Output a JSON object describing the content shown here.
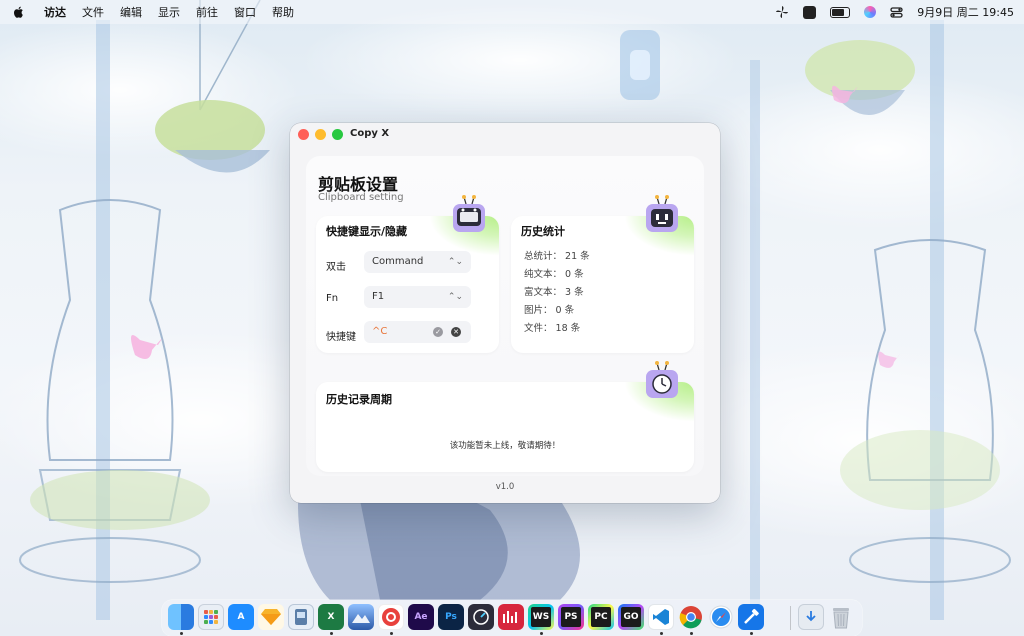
{
  "menubar": {
    "items": [
      "访达",
      "文件",
      "编辑",
      "显示",
      "前往",
      "窗口",
      "帮助"
    ],
    "clock": "9月9日 周二 19:45"
  },
  "window": {
    "title": "Copy X",
    "heading": "剪贴板设置",
    "subheading": "Clipboard setting",
    "shortcut_card": {
      "title": "快捷键显示/隐藏",
      "rows": [
        {
          "label": "双击",
          "value": "Command"
        },
        {
          "label": "Fn",
          "value": "F1"
        },
        {
          "label": "快捷键",
          "value": "^C"
        }
      ]
    },
    "stats_card": {
      "title": "历史统计",
      "lines": [
        "总统计： 21 条",
        "纯文本： 0 条",
        "富文本： 3 条",
        "图片： 0 条",
        "文件： 18 条"
      ]
    },
    "history_card": {
      "title": "历史记录周期",
      "notice": "该功能暂未上线，敬请期待！"
    },
    "version": "v1.0"
  },
  "dock": {
    "apps": [
      {
        "name": "finder",
        "label": "",
        "color": "#2f8bff"
      },
      {
        "name": "launchpad",
        "label": "",
        "color": "#e9eef5"
      },
      {
        "name": "app-store",
        "label": "A",
        "color": "#1e8cff"
      },
      {
        "name": "sketch",
        "label": "",
        "color": "#f7b32b"
      },
      {
        "name": "preview",
        "label": "",
        "color": "#5a7ea8"
      },
      {
        "name": "excel",
        "label": "X",
        "color": "#1d7a43"
      },
      {
        "name": "monterey",
        "label": "",
        "color": "#3b6fb6"
      },
      {
        "name": "netease-music",
        "label": "",
        "color": "#e8413c"
      },
      {
        "name": "after-effects",
        "label": "Ae",
        "color": "#1f0a4a"
      },
      {
        "name": "photoshop",
        "label": "Ps",
        "color": "#0b2445"
      },
      {
        "name": "instruments",
        "label": "",
        "color": "#2c2c3a"
      },
      {
        "name": "mweb",
        "label": "",
        "color": "#d7263d"
      },
      {
        "name": "webstorm",
        "label": "WS",
        "color": "#1b1b1b"
      },
      {
        "name": "phpstorm",
        "label": "PS",
        "color": "#1b1b1b"
      },
      {
        "name": "pycharm",
        "label": "PC",
        "color": "#1b1b1b"
      },
      {
        "name": "goland",
        "label": "GO",
        "color": "#1b1b1b"
      },
      {
        "name": "vscode",
        "label": "",
        "color": "#1a84d6"
      },
      {
        "name": "chrome",
        "label": "",
        "color": "#ffffff"
      },
      {
        "name": "safari",
        "label": "",
        "color": "#2a8cf0"
      },
      {
        "name": "xcode",
        "label": "",
        "color": "#1676e8"
      },
      {
        "name": "downloads",
        "label": "",
        "color": "#e6ebf1"
      },
      {
        "name": "trash",
        "label": "",
        "color": "#cdd3da"
      }
    ]
  },
  "colors": {
    "accent_green": "#b7ef8a",
    "shortcut_orange": "#e8753a",
    "mascot_purple": "#b9a6f0"
  }
}
